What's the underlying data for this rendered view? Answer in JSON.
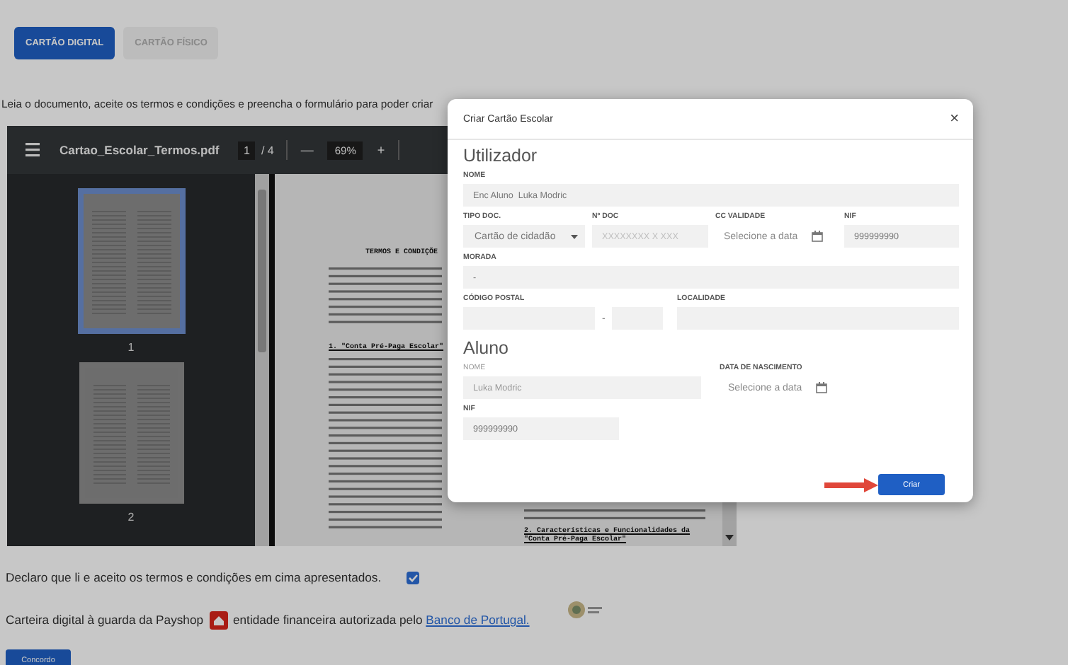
{
  "tabs": [
    {
      "label": "CARTÃO DIGITAL",
      "selected": true
    },
    {
      "label": "CARTÃO FÍSICO",
      "selected": false
    }
  ],
  "instructions": "Leia o documento, aceite os termos e condições e preencha o formulário para poder criar",
  "pdf_viewer": {
    "file_name": "Cartao_Escolar_Termos.pdf",
    "current_page": "1",
    "page_total": "/ 4",
    "zoom_out": "—",
    "zoom": "69%",
    "zoom_in": "+",
    "thumbnails": [
      {
        "label": "1",
        "selected": true
      },
      {
        "label": "2",
        "selected": false
      }
    ],
    "document": {
      "heading": "TERMOS E CONDIÇÕE",
      "section_1": "1.  \"Conta Pré-Paga Escolar\"",
      "section_2": "2.  Características e Funcionalidades da \"Conta Pré-Paga Escolar\""
    }
  },
  "declaration": {
    "text": "Declaro que li e aceito os termos e condições em cima apresentados.",
    "checked": true
  },
  "wallet_notice": {
    "before": "Carteira digital à guarda da Payshop",
    "after": "entidade financeira autorizada pelo",
    "link": "Banco de Portugal."
  },
  "agree_button": "Concordo",
  "dialog": {
    "title": "Criar Cartão Escolar",
    "close": "×",
    "sections": [
      {
        "heading": "Utilizador",
        "rows": [
          [
            {
              "kind": "text",
              "label": "NOME",
              "value": "Enc Aluno  Luka Modric",
              "disabled": false
            }
          ],
          [
            {
              "kind": "select",
              "label": "TIPO DOC.",
              "value": "Cartão de cidadão",
              "disabled": false
            },
            {
              "kind": "text",
              "label": "Nº DOC",
              "placeholder": "XXXXXXXX X XXX",
              "disabled": false
            },
            {
              "kind": "date",
              "label": "CC VALIDADE",
              "placeholder": "Selecione a data",
              "disabled": false
            },
            {
              "kind": "text",
              "label": "NIF",
              "value": "999999990",
              "disabled": false
            }
          ],
          [
            {
              "kind": "text",
              "label": "MORADA",
              "value": "-",
              "disabled": false
            }
          ],
          [
            {
              "kind": "postal",
              "label": "CÓDIGO POSTAL",
              "separator": "-",
              "disabled": false
            },
            {
              "kind": "text",
              "label": "LOCALIDADE",
              "disabled": false
            }
          ]
        ]
      },
      {
        "heading": "Aluno",
        "rows": [
          [
            {
              "kind": "text",
              "label": "NOME",
              "value": "Luka Modric",
              "disabled": true
            },
            {
              "kind": "date",
              "label": "DATA DE NASCIMENTO",
              "placeholder": "Selecione a data",
              "disabled": false
            }
          ],
          [
            {
              "kind": "text",
              "label": "NIF",
              "value": "999999990",
              "disabled": false
            }
          ]
        ]
      }
    ],
    "submit": "Criar"
  }
}
